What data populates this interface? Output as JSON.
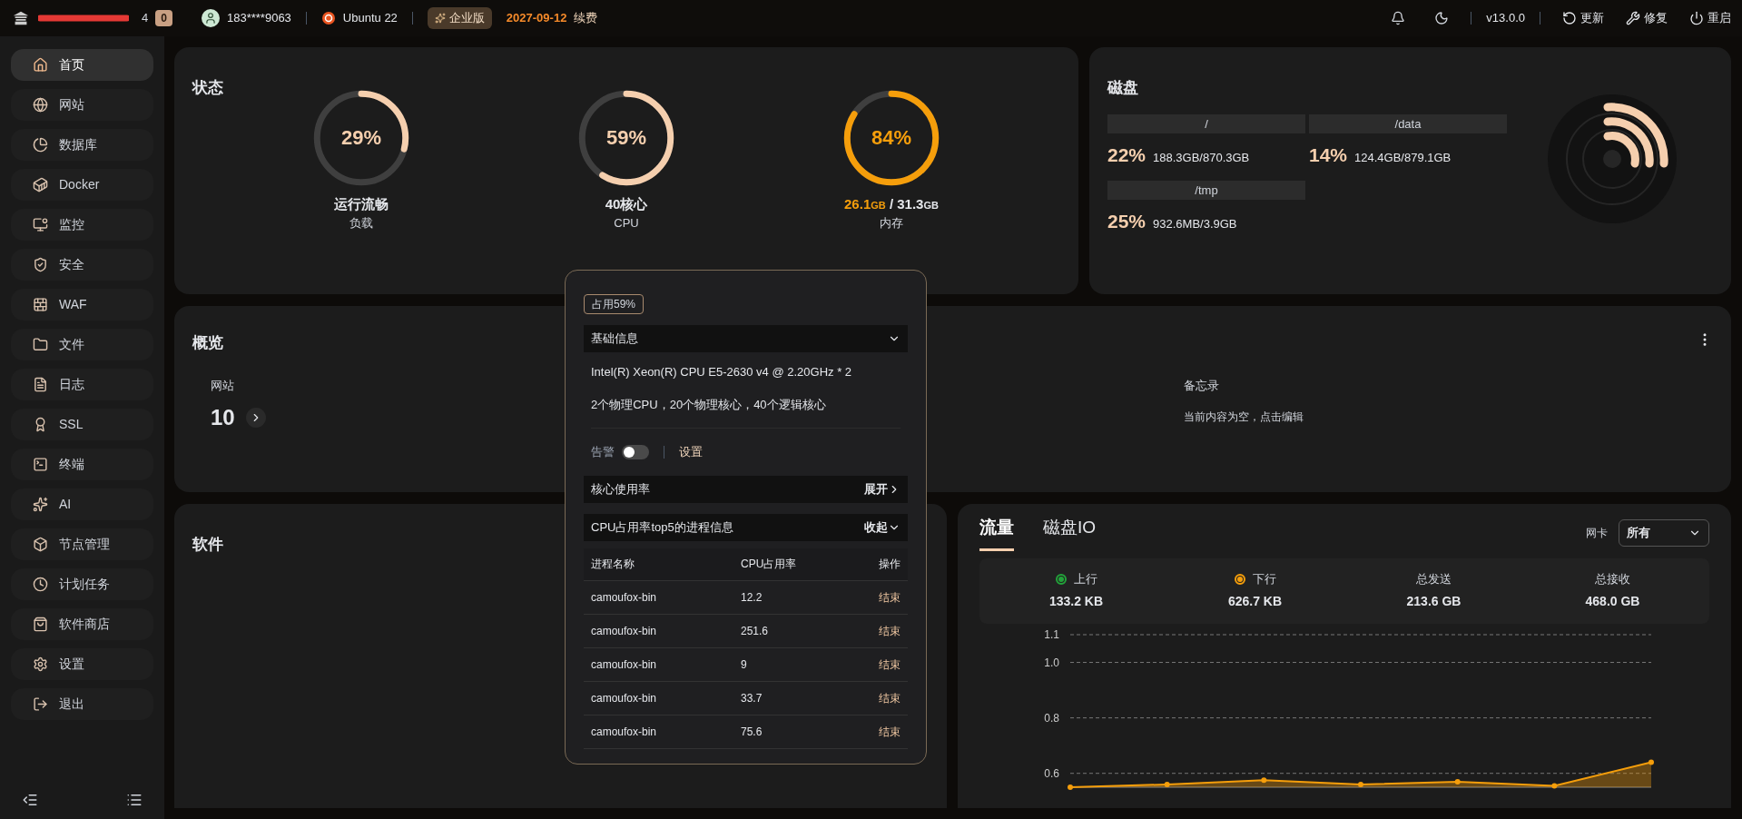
{
  "topbar": {
    "brand_fragment": "4",
    "badge": "0",
    "user": "183****9063",
    "os": "Ubuntu 22",
    "edition": "企业版",
    "expiry": "2027-09-12",
    "renew": "续费",
    "version": "v13.0.0",
    "actions": [
      {
        "label": "更新",
        "kind": "refresh"
      },
      {
        "label": "修复",
        "kind": "repair"
      },
      {
        "label": "重启",
        "kind": "power"
      }
    ]
  },
  "sidebar": {
    "items": [
      {
        "label": "首页",
        "kind": "home",
        "selected": true
      },
      {
        "label": "网站",
        "kind": "globe",
        "selected": false
      },
      {
        "label": "数据库",
        "kind": "database",
        "selected": false
      },
      {
        "label": "Docker",
        "kind": "docker",
        "selected": false
      },
      {
        "label": "监控",
        "kind": "monitor",
        "selected": false
      },
      {
        "label": "安全",
        "kind": "shield",
        "selected": false
      },
      {
        "label": "WAF",
        "kind": "waf",
        "selected": false
      },
      {
        "label": "文件",
        "kind": "folder",
        "selected": false
      },
      {
        "label": "日志",
        "kind": "log",
        "selected": false
      },
      {
        "label": "SSL",
        "kind": "ssl",
        "selected": false
      },
      {
        "label": "终端",
        "kind": "terminal",
        "selected": false
      },
      {
        "label": "AI",
        "kind": "ai",
        "selected": false
      },
      {
        "label": "节点管理",
        "kind": "node",
        "selected": false
      },
      {
        "label": "计划任务",
        "kind": "cron",
        "selected": false
      },
      {
        "label": "软件商店",
        "kind": "store",
        "selected": false
      },
      {
        "label": "设置",
        "kind": "settings",
        "selected": false
      },
      {
        "label": "退出",
        "kind": "logout",
        "selected": false
      }
    ]
  },
  "status": {
    "title": "状态",
    "gauges": [
      {
        "kind": "plain",
        "value": "29%",
        "level": 0.29,
        "label": "运行流畅",
        "sublabel": "负载"
      },
      {
        "kind": "plain",
        "value": "59%",
        "level": 0.59,
        "label": "40核心",
        "sublabel": "CPU"
      },
      {
        "kind": "memory",
        "value": "84%",
        "level": 0.84,
        "used": "26.1",
        "used_unit": "GB",
        "separator": "/",
        "total": "31.3",
        "total_unit": "GB",
        "sublabel": "内存"
      }
    ]
  },
  "disk": {
    "title": "磁盘",
    "mounts": [
      {
        "path": "/",
        "percent": "22%",
        "usage": "188.3GB/870.3GB"
      },
      {
        "path": "/data",
        "percent": "14%",
        "usage": "124.4GB/879.1GB"
      },
      {
        "path": "/tmp",
        "percent": "25%",
        "usage": "932.6MB/3.9GB"
      }
    ]
  },
  "overview": {
    "title": "概览",
    "stat_label": "网站",
    "stat_value": "10",
    "memo_label": "备忘录",
    "memo_text": "当前内容为空，点击编辑"
  },
  "cpu_popup": {
    "badge": "占用59%",
    "basic_title": "基础信息",
    "cpu_model": "Intel(R) Xeon(R) CPU E5-2630 v4 @ 2.20GHz * 2",
    "cpu_cores": "2个物理CPU，20个物理核心，40个逻辑核心",
    "alert_label": "告警",
    "alert_on": false,
    "alert_settings": "设置",
    "core_title": "核心使用率",
    "core_toggle": "展开",
    "core_expanded": false,
    "top_title": "CPU占用率top5的进程信息",
    "top_toggle": "收起",
    "top_expanded": true,
    "columns": [
      "进程名称",
      "CPU占用率",
      "操作"
    ],
    "rows": [
      {
        "name": "camoufox-bin",
        "cpu": "12.2",
        "action": "结束"
      },
      {
        "name": "camoufox-bin",
        "cpu": "251.6",
        "action": "结束"
      },
      {
        "name": "camoufox-bin",
        "cpu": "9",
        "action": "结束"
      },
      {
        "name": "camoufox-bin",
        "cpu": "33.7",
        "action": "结束"
      },
      {
        "name": "camoufox-bin",
        "cpu": "75.6",
        "action": "结束"
      }
    ]
  },
  "software": {
    "title": "软件"
  },
  "traffic": {
    "tabs": [
      {
        "label": "流量",
        "selected": true
      },
      {
        "label": "磁盘IO",
        "selected": false
      }
    ],
    "nic_label": "网卡",
    "nic_value": "所有",
    "stats": [
      {
        "label": "上行",
        "value": "133.2 KB",
        "kind": "legend",
        "color": "#22a33a"
      },
      {
        "label": "下行",
        "value": "626.7 KB",
        "kind": "legend",
        "color": "#f59e0b"
      },
      {
        "label": "总发送",
        "value": "213.6 GB",
        "kind": "plain"
      },
      {
        "label": "总接收",
        "value": "468.0 GB",
        "kind": "plain"
      }
    ],
    "chart_data": {
      "type": "area",
      "grid": true,
      "ylim": [
        0.55,
        1.1
      ],
      "yticks": [
        0.6,
        0.8,
        {
          "value": 1,
          "label": "1.0"
        },
        1.1
      ],
      "series": [
        {
          "color": "#f59e0b",
          "values": [
            0.55,
            0.56,
            0.575,
            0.56,
            0.57,
            0.555,
            0.64
          ]
        }
      ]
    }
  }
}
